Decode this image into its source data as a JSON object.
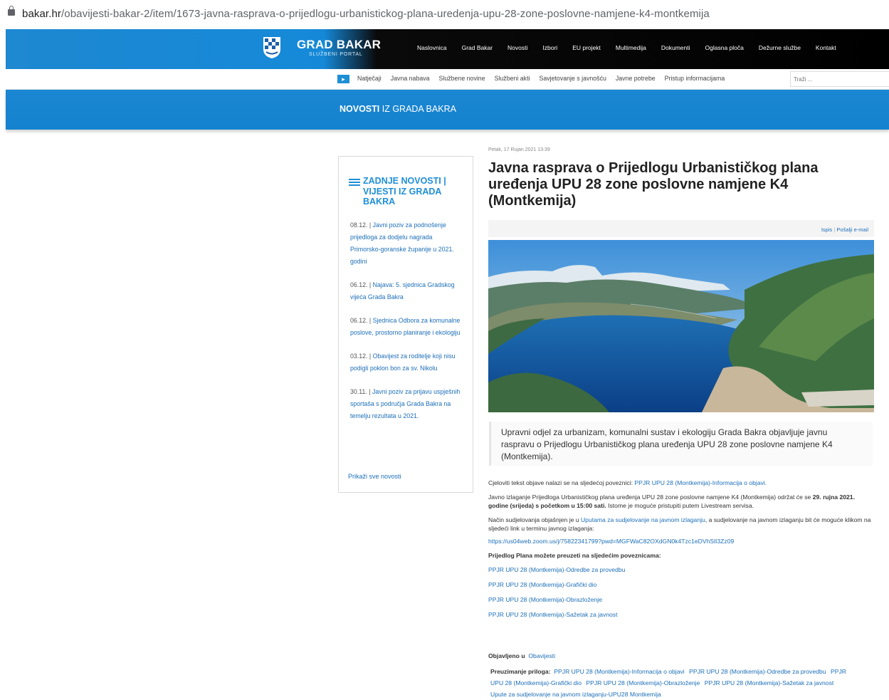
{
  "browser": {
    "url_host": "bakar.hr",
    "url_path": "/obavijesti-bakar-2/item/1673-javna-rasprava-o-prijedlogu-urbanistickog-plana-uredenja-upu-28-zone-poslovne-namjene-k4-montkemija"
  },
  "brand": {
    "title": "GRAD BAKAR",
    "subtitle": "SLUŽBENI PORTAL",
    "primary_color": "#1d8fd6"
  },
  "main_nav": [
    "Naslovnica",
    "Grad Bakar",
    "Novosti",
    "Izbori",
    "EU projekt",
    "Multimedija",
    "Dokumenti",
    "Oglasna ploča",
    "Dežurne službe",
    "Kontakt"
  ],
  "sub_nav": {
    "items": [
      "Natječaji",
      "Javna nabava",
      "Službene novine",
      "Službeni akti",
      "Savjetovanje s javnošću",
      "Javne potrebe",
      "Pristup informacijama"
    ],
    "search_placeholder": "Traži ..."
  },
  "banner": {
    "title_bold": "NOVOSTI",
    "title_rest": " IZ GRADA BAKRA"
  },
  "sidebar": {
    "heading": "ZADNJE NOVOSTI | VIJESTI IZ GRADA BAKRA",
    "items": [
      {
        "date": "08.12.",
        "title": "Javni poziv za podnošenje prijedloga za dodjelu nagrada Primorsko-goranske županije u 2021. godini"
      },
      {
        "date": "06.12.",
        "title": "Najava: 5. sjednica Gradskog vijeća Grada Bakra"
      },
      {
        "date": "06.12.",
        "title": "Sjednica Odbora za komunalne poslove, prostorno planiranje i ekologiju"
      },
      {
        "date": "03.12.",
        "title": "Obavijest za roditelje koji nisu podigli poklon bon za sv. Nikolu"
      },
      {
        "date": "30.11.",
        "title": "Javni poziv za prijavu uspješnih sportaša s područja Grada Bakra na temelju rezultata u 2021."
      }
    ],
    "more": "Prikaži sve novosti"
  },
  "article": {
    "date": "Petak, 17 Rujan 2021 13:39",
    "title": "Javna rasprava o Prijedlogu Urbanističkog plana uređenja UPU 28 zone poslovne namjene K4 (Montkemija)",
    "tools": {
      "print": "Ispis",
      "separator": "|",
      "email": "Pošalji e-mail"
    },
    "lead": "Upravni odjel za urbanizam, komunalni sustav i ekologiju Grada Bakra objavljuje javnu raspravu o Prijedlogu Urbanističkog plana uređenja UPU 28 zone poslovne namjene K4 (Montkemija).",
    "p1_text": "Cjeloviti tekst objave nalazi se na sljedećoj poveznici: ",
    "p1_link": "PPJR UPU 28 (Montkemija)-Informacija o objavi.",
    "p2_text": "Javno izlaganje Prijedloga Urbanističkog plana uređenja UPU 28 zone poslovne namjene K4 (Montkemija) održat će se ",
    "p2_bold": "29. rujna 2021. godine (srijeda) s početkom u 15:00 sati.",
    "p2_tail": " Istome je moguće pristupiti putem Livestream servisa.",
    "p3_text": "Način sudjelovanja objašnjen je u ",
    "p3_link": "Uputama za sudjelovanje na javnom izlaganju",
    "p3_tail": ", a sudjelovanje na javnom izlaganju bit će moguće klikom na sljedeći link u terminu javnog izlaganja:",
    "zoom_link": "https://us04web.zoom.us/j/75822341799?pwd=MGFWaC82OXdGN0k4Tzc1eDVhSlI3Zz09",
    "download_heading": "Prijedlog Plana možete preuzeti na sljedećim poveznicama:",
    "download_links": [
      "PPJR UPU 28 (Montkemija)-Odredbe za provedbu",
      "PPJR UPU 28 (Montkemija)-Grafički dio",
      "PPJR UPU 28 (Montkemija)-Obrazloženje",
      "PPJR UPU 28 (Montkemija)-Sažetak za javnost"
    ],
    "published_label": "Objavljeno u",
    "published_category": "Obavijesti",
    "attachments_label": "Preuzimanje priloga:",
    "attachments": [
      "PPJR UPU 28 (Montkemija)-Informacija o objavi",
      "PPJR UPU 28 (Montkemija)-Odredbe za provedbu",
      "PPJR UPU 28 (Montkemija)-Grafički dio",
      "PPJR UPU 28 (Montkemija)-Obrazloženje",
      "PPJR UPU 28 (Montkemija)-Sažetak za javnost",
      "Upute za sudjelovanje na javnom izlaganju-UPU28 Montkemija"
    ]
  }
}
